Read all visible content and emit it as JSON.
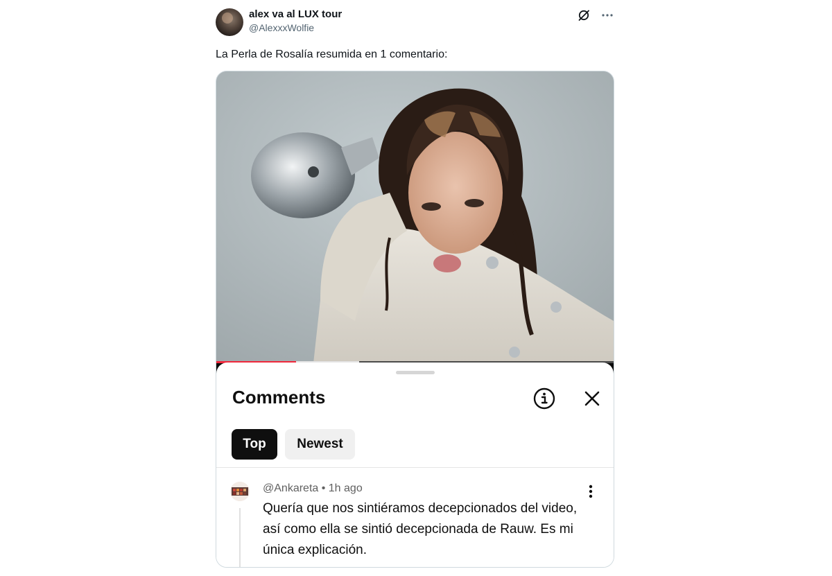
{
  "author": {
    "display_name": "alex va al LUX tour",
    "handle": "@AlexxxWolfie"
  },
  "header_icons": [
    "grok-icon",
    "more-horizontal-icon"
  ],
  "tweet": {
    "text": "La Perla de Rosalía resumida en 1 comentario:"
  },
  "video": {
    "progress_played": 0.2,
    "progress_buffered": 0.36
  },
  "comments_panel": {
    "title": "Comments",
    "tabs": [
      {
        "label": "Top",
        "selected": true
      },
      {
        "label": "Newest",
        "selected": false
      }
    ],
    "comment": {
      "author_and_time": "@Ankareta • 1h ago",
      "text": "Quería que nos sintiéramos decepcionados del video, así como ella se sintió decepcionada de Rauw. Es mi única explicación."
    }
  },
  "colors": {
    "text_primary": "#0f1419",
    "text_secondary": "#536471",
    "progress_red": "#f0273b",
    "chip_selected_bg": "#0f0f0f",
    "chip_unselected_bg": "#f0f0f0"
  }
}
